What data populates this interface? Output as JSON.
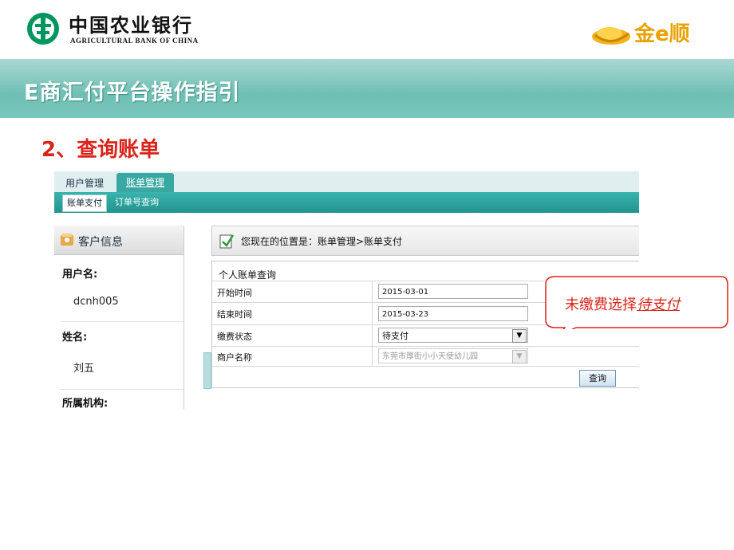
{
  "header": {
    "bank_name_cn": "中国农业银行",
    "bank_name_en": "AGRICULTURAL BANK OF CHINA",
    "brand_text": "金e顺"
  },
  "banner": {
    "title": "E商汇付平台操作指引"
  },
  "section": {
    "title": "2、查询账单"
  },
  "app": {
    "tabs": [
      {
        "label": "用户管理"
      },
      {
        "label": "账单管理"
      }
    ],
    "subnav": [
      {
        "label": "账单支付"
      },
      {
        "label": "订单号查询"
      }
    ],
    "sidebar": {
      "header": "客户信息",
      "fields": [
        {
          "label": "用户名:",
          "value": "dcnh005"
        },
        {
          "label": "姓名:",
          "value": "刘五"
        },
        {
          "label": "所属机构:",
          "value": ""
        }
      ]
    },
    "breadcrumb": "您现在的位置是：账单管理>账单支付",
    "form": {
      "title": "个人账单查询",
      "rows": [
        {
          "label": "开始时间",
          "value": "2015-03-01"
        },
        {
          "label": "结束时间",
          "value": "2015-03-23"
        },
        {
          "label": "缴费状态",
          "value": "待支付"
        },
        {
          "label": "商户名称",
          "value": "东莞市厚街小小天使幼儿园"
        }
      ],
      "query_button": "查询"
    }
  },
  "callout": {
    "text_prefix": "未缴费选择",
    "text_emphasis": "待支付"
  },
  "colors": {
    "teal": "#3aa8a2",
    "red": "#d9241b",
    "gold": "#e8a200"
  }
}
